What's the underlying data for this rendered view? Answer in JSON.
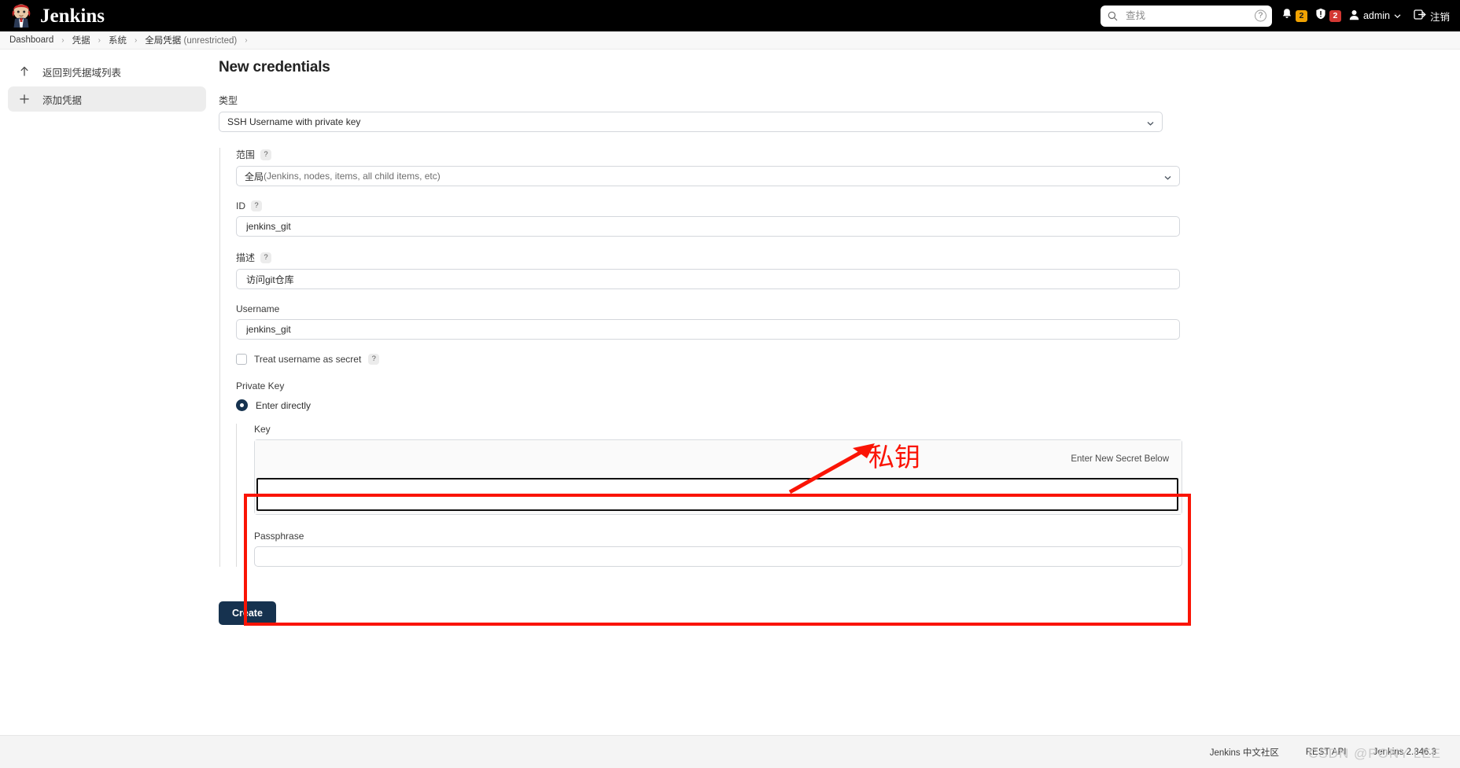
{
  "header": {
    "brand": "Jenkins",
    "logo_icon": "jenkins-butler-logo",
    "search": {
      "placeholder": "查找",
      "value": "",
      "icon": "search-icon",
      "help_icon": "question-mark-icon",
      "help_label": "?"
    },
    "notifications": {
      "icon": "bell-icon",
      "count": "2"
    },
    "security": {
      "icon": "shield-alert-icon",
      "count": "2"
    },
    "user": {
      "icon": "user-icon",
      "name": "admin",
      "chevron": "chevron-down-icon"
    },
    "logout": {
      "icon": "logout-icon",
      "label": "注销"
    }
  },
  "breadcrumb": {
    "separator": "›",
    "items": [
      {
        "label": "Dashboard"
      },
      {
        "label": "凭据"
      },
      {
        "label": "系统"
      },
      {
        "label": "全局凭据",
        "suffix": " (unrestricted)"
      }
    ]
  },
  "sidebar": {
    "items": [
      {
        "label": "返回到凭据域列表",
        "icon": "arrow-up-icon",
        "active": false
      },
      {
        "label": "添加凭据",
        "icon": "plus-icon",
        "active": true
      }
    ]
  },
  "main": {
    "title": "New credentials",
    "type_field": {
      "label": "类型",
      "value": "SSH Username with private key",
      "chevron": "chevron-down-icon"
    },
    "scope_field": {
      "label": "范围",
      "help": "?",
      "value_bold": "全局",
      "value_rest": " (Jenkins, nodes, items, all child items, etc)",
      "chevron": "chevron-down-icon"
    },
    "id_field": {
      "label": "ID",
      "help": "?",
      "value": "jenkins_git",
      "placeholder": ""
    },
    "description_field": {
      "label": "描述",
      "help": "?",
      "value": "访问git仓库",
      "placeholder": ""
    },
    "username_field": {
      "label": "Username",
      "value": "jenkins_git",
      "placeholder": ""
    },
    "treat_secret": {
      "label": "Treat username as secret",
      "help": "?",
      "checked": false
    },
    "private_key": {
      "label": "Private Key",
      "option_label": "Enter directly",
      "selected": true,
      "key_label": "Key",
      "secret_notice": "Enter New Secret Below",
      "secret_value": "",
      "secret_placeholder": ""
    },
    "passphrase_field": {
      "label": "Passphrase",
      "value": "",
      "placeholder": ""
    },
    "create_button": "Create"
  },
  "annotations": {
    "red_label": "私钥",
    "arrow_icon": "red-arrow-up-right-icon",
    "box_color": "#fa1405"
  },
  "footer": {
    "community_link": "Jenkins 中文社区",
    "rest_api_link": "REST API",
    "version": "Jenkins 2.346.3",
    "watermark": "CSDN @PONY LEE"
  }
}
